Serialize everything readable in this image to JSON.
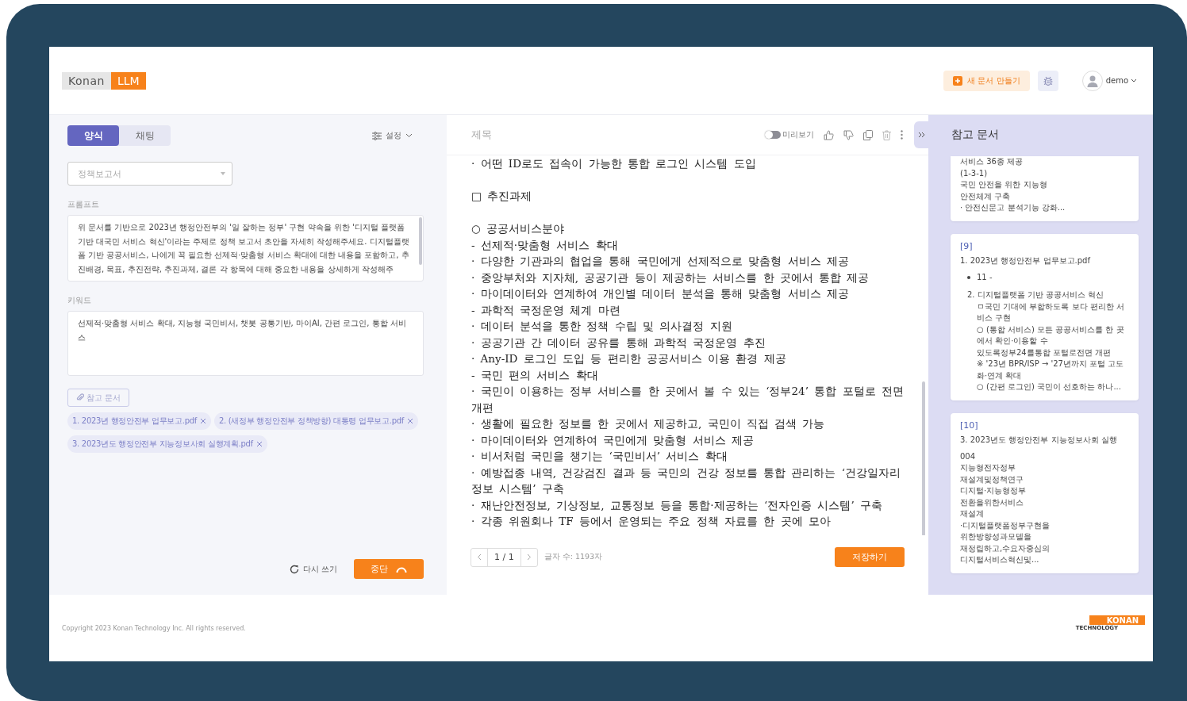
{
  "header": {
    "logo": [
      "Konan",
      "LLM"
    ],
    "new_doc_button": "새 문서 만들기",
    "user": "demo"
  },
  "left": {
    "tabs": [
      {
        "label": "양식",
        "selected": true
      },
      {
        "label": "채팅",
        "selected": false
      }
    ],
    "settings": "설정",
    "template_select": {
      "placeholder": "정책보고서"
    },
    "prompt": {
      "label": "프롬프트",
      "value": "위 문서를 기반으로 2023년 행정안전부의 '일 잘하는 정부' 구현 약속을 위한 '디지털 플랫폼 기반 대국민 서비스 혁신'이라는 주제로 정책 보고서 초안을 자세히 작성해주세요. 디지털플랫폼 기반 공공서비스, 나에게 꼭 필요한 선제적·맞춤형 서비스 확대에 대한 내용을 포함하고, 추진배경, 목표, 추진전략, 추진과제, 결론 각 항목에 대해 중요한 내용을 상세하게 작성해주"
    },
    "keywords": {
      "label": "키워드",
      "value": "선제적·맞춤형 서비스 확대, 지능형 국민비서, 챗봇 공통기반, 마이AI, 간편 로그인, 통합 서비스"
    },
    "reference_button": "참고 문서",
    "reference_files": [
      "1. 2023년 행정안전부 업무보고.pdf",
      "2. (새정부 행정안전부 정책방향) 대통령 업무보고.pdf",
      "3. 2023년도 행정안전부 지능정보사회 실행계획.pdf"
    ],
    "rewrite_button": "다시 쓰기",
    "stop_button": "중단"
  },
  "editor": {
    "title": {
      "placeholder": "제목"
    },
    "preview": {
      "label": "미리보기",
      "on": false
    },
    "lines": [
      {
        "kind": "item",
        "text": "·  어떤 ID로도 접속이 가능한 통합 로그인 시스템 도입"
      },
      {
        "kind": "section",
        "text": "□  추진과제"
      },
      {
        "kind": "section",
        "text": "○  공공서비스분야"
      },
      {
        "kind": "item",
        "text": "- 선제적·맞춤형 서비스 확대"
      },
      {
        "kind": "item",
        "text": "·  다양한 기관과의 협업을 통해 국민에게 선제적으로 맞춤형 서비스 제공"
      },
      {
        "kind": "item",
        "text": "·  중앙부처와 지자체, 공공기관 등이 제공하는 서비스를 한 곳에서 통합 제공"
      },
      {
        "kind": "item",
        "text": "·  마이데이터와 연계하여 개인별 데이터 분석을 통해 맞춤형 서비스 제공"
      },
      {
        "kind": "item",
        "text": "- 과학적 국정운영 체계 마련"
      },
      {
        "kind": "item",
        "text": "·  데이터 분석을 통한 정책 수립 및 의사결정 지원"
      },
      {
        "kind": "item",
        "text": "·  공공기관 간 데이터 공유를 통해 과학적 국정운영 추진"
      },
      {
        "kind": "item",
        "text": "·  Any-ID 로그인 도입 등 편리한 공공서비스 이용 환경 제공"
      },
      {
        "kind": "item",
        "text": "- 국민 편의 서비스 확대"
      },
      {
        "kind": "item",
        "text": "·  국민이 이용하는 정부 서비스를 한 곳에서 볼 수 있는 ‘정부24’ 통합 포털로 전면 개편"
      },
      {
        "kind": "item",
        "text": "·  생활에 필요한 정보를 한 곳에서 제공하고, 국민이 직접 검색 가능"
      },
      {
        "kind": "item",
        "text": "·  마이데이터와 연계하여 국민에게 맞춤형 서비스 제공"
      },
      {
        "kind": "item",
        "text": "·  비서처럼 국민을 챙기는 ‘국민비서’ 서비스 확대"
      },
      {
        "kind": "item",
        "text": "·  예방접종 내역, 건강검진 결과 등 국민의 건강 정보를 통합 관리하는 ‘건강일자리 정보 시스템’ 구축"
      },
      {
        "kind": "item",
        "text": "·  재난안전정보, 기상정보, 교통정보 등을 통합·제공하는 ‘전자인증 시스템’ 구축"
      },
      {
        "kind": "item",
        "text": "·  각종 위원회나 TF 등에서 운영되는 주요 정책 자료를 한 곳에 모아"
      }
    ],
    "pager": "1 / 1",
    "char_count": "글자 수: 1193자",
    "save_button": "저장하기"
  },
  "reference_panel": {
    "title": "참고 문서",
    "cards": [
      {
        "lines": [
          {
            "kind": "plain",
            "text": "서비스 36종 제공"
          },
          {
            "kind": "plain",
            "text": "(1-3-1)"
          },
          {
            "kind": "plain",
            "text": "국민 안전을 위한 지능형"
          },
          {
            "kind": "plain",
            "text": "안전체계 구축"
          },
          {
            "kind": "plain",
            "text": "· 안전신문고 분석기능 강화..."
          }
        ]
      },
      {
        "ref": "[9]",
        "title": "1. 2023년 행정안전부 업무보고.pdf",
        "lines": [
          {
            "kind": "bullet",
            "text": "11 -"
          },
          {
            "kind": "numbered",
            "number": "2.",
            "text": "디지털플랫폼 기반 공공서비스 혁신"
          },
          {
            "kind": "sub",
            "text": "ㅁ국민 기대에 부합하도록 보다 편리한 서비스 구현"
          },
          {
            "kind": "sub",
            "text": "○ (통합 서비스) 모든 공공서비스를 한 곳에서 확인·이용할 수"
          },
          {
            "kind": "sub",
            "text": "있도록정부24를통합 포털로전면 개편"
          },
          {
            "kind": "sub",
            "text": "※ '23년 BPR/ISP → '27년까지 포털 고도화·연계 확대"
          },
          {
            "kind": "sub",
            "text": "○ (간편 로그인) 국민이 선호하는 하나..."
          }
        ]
      },
      {
        "ref": "[10]",
        "title": "3. 2023년도 행정안전부 지능정보사회 실행",
        "lines": [
          {
            "kind": "plain",
            "text": "004"
          },
          {
            "kind": "plain",
            "text": "지능형전자정부"
          },
          {
            "kind": "plain",
            "text": "재설계및정책연구"
          },
          {
            "kind": "plain",
            "text": "디지털·지능형정부"
          },
          {
            "kind": "plain",
            "text": "전환을위한서비스"
          },
          {
            "kind": "plain",
            "text": "재설계"
          },
          {
            "kind": "plain",
            "text": "·디지털플랫폼정부구현을"
          },
          {
            "kind": "plain",
            "text": "위한방향성과모델을"
          },
          {
            "kind": "plain",
            "text": "재정립하고,수요자중심의"
          },
          {
            "kind": "plain",
            "text": "디지털서비스혁신및..."
          }
        ]
      }
    ]
  },
  "footer": {
    "copyright": "Copyright 2023 Konan Technology Inc. All rights reserved.",
    "brand": [
      "KONAN",
      "TECHNOLOGY"
    ]
  }
}
